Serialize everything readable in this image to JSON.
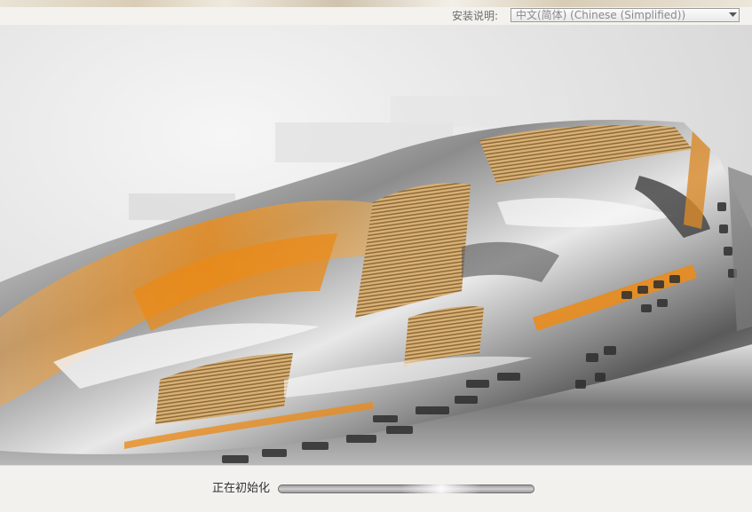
{
  "language": {
    "label": "安装说明:",
    "selected": "中文(简体) (Chinese (Simplified))"
  },
  "status": {
    "text": "正在初始化"
  },
  "progress": {
    "state": "indeterminate",
    "glow_position": 0.7
  },
  "icons": {
    "dropdown": "chevron-down-icon"
  },
  "colors": {
    "accent_orange": "#e8952a",
    "background": "#f1f0ec"
  }
}
